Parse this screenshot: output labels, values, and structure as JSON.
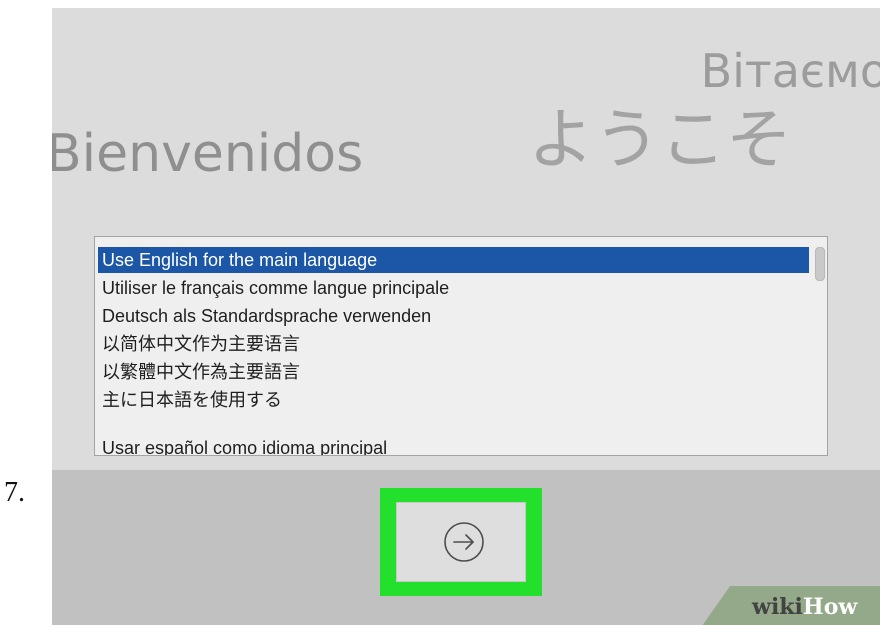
{
  "step_number": "7.",
  "greetings": {
    "ukrainian": "Вітаємо",
    "japanese": "ようこそ",
    "spanish": "Bienvenidos"
  },
  "language_list": {
    "items": [
      {
        "label": "Use English for the main language",
        "selected": true
      },
      {
        "label": "Utiliser le français comme langue principale",
        "selected": false
      },
      {
        "label": "Deutsch als Standardsprache verwenden",
        "selected": false
      },
      {
        "label": "以简体中文作为主要语言",
        "selected": false
      },
      {
        "label": "以繁體中文作為主要語言",
        "selected": false
      },
      {
        "label": "主に日本語を使用する",
        "selected": false
      },
      {
        "label": "Usar español como idioma principal",
        "selected": false
      }
    ]
  },
  "continue_button": {
    "icon": "arrow-right-circle-icon"
  },
  "watermark": {
    "wiki": "wiki",
    "how": "How"
  },
  "colors": {
    "selection": "#1b57a6",
    "highlight": "#22e02c",
    "background": "#dcdcdc"
  }
}
